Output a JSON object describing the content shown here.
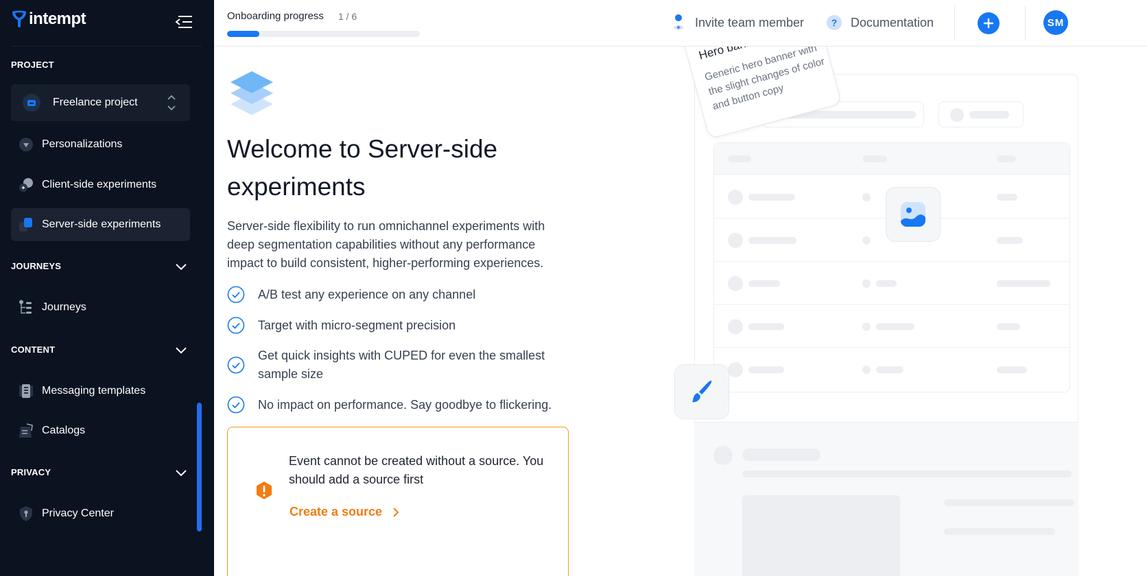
{
  "app": {
    "name": "intempt"
  },
  "sidebar": {
    "project_section": "PROJECT",
    "project_name": "Freelance project",
    "items": [
      {
        "label": "Personalizations",
        "icon": "personalization-icon"
      },
      {
        "label": "Client-side experiments",
        "icon": "client-experiment-icon"
      },
      {
        "label": "Server-side experiments",
        "icon": "server-experiment-icon",
        "active": true
      }
    ],
    "journeys_section": "JOURNEYS",
    "journeys_items": [
      {
        "label": "Journeys",
        "icon": "journeys-icon"
      }
    ],
    "content_section": "CONTENT",
    "content_items": [
      {
        "label": "Messaging templates",
        "icon": "templates-icon"
      },
      {
        "label": "Catalogs",
        "icon": "catalogs-icon"
      }
    ],
    "privacy_section": "PRIVACY",
    "privacy_items": [
      {
        "label": "Privacy Center",
        "icon": "shield-icon"
      }
    ]
  },
  "topbar": {
    "onboarding_title": "Onboarding progress",
    "onboarding_count": "1 / 6",
    "onboarding_progress": 0.167,
    "invite_label": "Invite team member",
    "docs_label": "Documentation",
    "avatar_initials": "SM"
  },
  "main": {
    "title": "Welcome to Server-side experiments",
    "description": "Server-side flexibility to run omnichannel experiments with deep segmentation capabilities without any performance impact to build consistent, higher-performing experiences.",
    "features": [
      "A/B test any experience on any channel",
      "Target with micro-segment precision",
      "Get quick insights with CUPED for even the smallest sample size",
      "No impact on performance. Say goodbye to flickering."
    ],
    "alert": {
      "text": "Event cannot be created without a source. You should add a source first",
      "link_label": "Create a source"
    }
  },
  "illustration": {
    "card_title": "Hero banner",
    "card_desc": "Generic hero banner with the slight changes of color and button copy",
    "partial_text": "r"
  },
  "colors": {
    "accent": "#1877f2",
    "sidebar_bg": "#0b1220",
    "warning": "#f27c12"
  }
}
